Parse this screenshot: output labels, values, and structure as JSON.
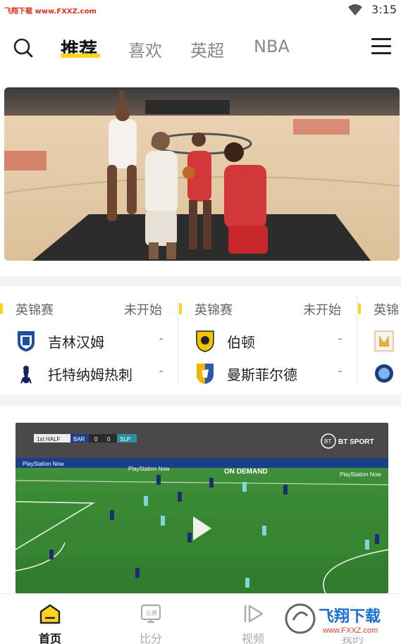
{
  "status_bar": {
    "watermark": "飞翔下载 www.FXXZ.com",
    "time": "3:15",
    "wifi_icon": "wifi-icon"
  },
  "nav": {
    "search_icon": "search-icon",
    "tabs": [
      {
        "label": "推荐",
        "active": true
      },
      {
        "label": "喜欢",
        "active": false
      },
      {
        "label": "英超",
        "active": false
      },
      {
        "label": "NBA",
        "active": false
      }
    ],
    "menu_icon": "hamburger-menu-icon",
    "accent_color": "#ffd21e"
  },
  "hero": {
    "image": "basketball-game-photo"
  },
  "matches": [
    {
      "league": "英锦赛",
      "status": "未开始",
      "home": {
        "name": "吉林汉姆",
        "score": "-"
      },
      "away": {
        "name": "托特纳姆热刺",
        "score": "-"
      }
    },
    {
      "league": "英锦赛",
      "status": "未开始",
      "home": {
        "name": "伯顿",
        "score": "-"
      },
      "away": {
        "name": "曼斯菲尔德",
        "score": "-"
      }
    },
    {
      "league": "英锦"
    }
  ],
  "video": {
    "scoreboard": {
      "half": "1st HALF",
      "home": "BAR",
      "home_score": "0",
      "away_score": "0",
      "away": "SLP"
    },
    "broadcaster": "BT SPORT",
    "ads": [
      "PlayStation Now",
      "PlayStation Now",
      "ON DEMAND",
      "PlayStation Now"
    ],
    "play_icon": "play-icon"
  },
  "bottom_nav": [
    {
      "label": "首页",
      "icon": "home-icon",
      "active": true
    },
    {
      "label": "比分",
      "icon": "scoreboard-icon",
      "icon_text": "比赛",
      "active": false
    },
    {
      "label": "视频",
      "icon": "video-play-icon",
      "active": false
    },
    {
      "label": "我的",
      "icon": "profile-icon",
      "active": false
    }
  ],
  "bottom_watermark": {
    "title": "飞翔下载",
    "url": "www.FXXZ.com"
  }
}
